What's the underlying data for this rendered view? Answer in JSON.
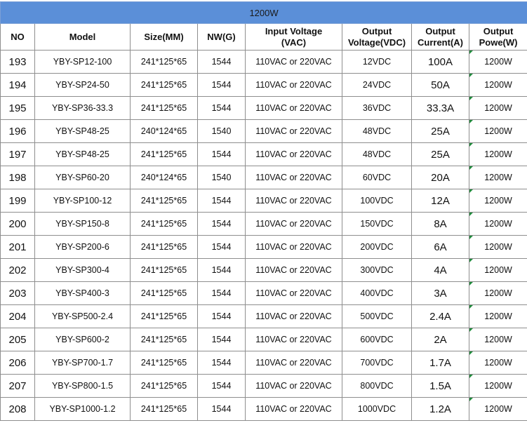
{
  "table": {
    "title": "1200W",
    "headers": {
      "no": "NO",
      "model": "Model",
      "size": "Size(MM)",
      "nw": "NW(G)",
      "input_1": "Input Voltage",
      "input_2": "(VAC)",
      "out_v_1": "Output",
      "out_v_2": "Voltage(VDC)",
      "out_c_1": "Output",
      "out_c_2": "Current(A)",
      "out_p_1": "Output",
      "out_p_2": "Powe(W)"
    },
    "rows": [
      {
        "no": "193",
        "model": "YBY-SP12-100",
        "size": "241*125*65",
        "nw": "1544",
        "input": "110VAC or 220VAC",
        "voltage": "12VDC",
        "current": "100A",
        "power": "1200W"
      },
      {
        "no": "194",
        "model": "YBY-SP24-50",
        "size": "241*125*65",
        "nw": "1544",
        "input": "110VAC or 220VAC",
        "voltage": "24VDC",
        "current": "50A",
        "power": "1200W"
      },
      {
        "no": "195",
        "model": "YBY-SP36-33.3",
        "size": "241*125*65",
        "nw": "1544",
        "input": "110VAC or 220VAC",
        "voltage": "36VDC",
        "current": "33.3A",
        "power": "1200W"
      },
      {
        "no": "196",
        "model": "YBY-SP48-25",
        "size": "240*124*65",
        "nw": "1540",
        "input": "110VAC or 220VAC",
        "voltage": "48VDC",
        "current": "25A",
        "power": "1200W"
      },
      {
        "no": "197",
        "model": "YBY-SP48-25",
        "size": "241*125*65",
        "nw": "1544",
        "input": "110VAC or 220VAC",
        "voltage": "48VDC",
        "current": "25A",
        "power": "1200W"
      },
      {
        "no": "198",
        "model": "YBY-SP60-20",
        "size": "240*124*65",
        "nw": "1540",
        "input": "110VAC or 220VAC",
        "voltage": "60VDC",
        "current": "20A",
        "power": "1200W"
      },
      {
        "no": "199",
        "model": "YBY-SP100-12",
        "size": "241*125*65",
        "nw": "1544",
        "input": "110VAC or 220VAC",
        "voltage": "100VDC",
        "current": "12A",
        "power": "1200W"
      },
      {
        "no": "200",
        "model": "YBY-SP150-8",
        "size": "241*125*65",
        "nw": "1544",
        "input": "110VAC or 220VAC",
        "voltage": "150VDC",
        "current": "8A",
        "power": "1200W"
      },
      {
        "no": "201",
        "model": "YBY-SP200-6",
        "size": "241*125*65",
        "nw": "1544",
        "input": "110VAC or 220VAC",
        "voltage": "200VDC",
        "current": "6A",
        "power": "1200W"
      },
      {
        "no": "202",
        "model": "YBY-SP300-4",
        "size": "241*125*65",
        "nw": "1544",
        "input": "110VAC or 220VAC",
        "voltage": "300VDC",
        "current": "4A",
        "power": "1200W"
      },
      {
        "no": "203",
        "model": "YBY-SP400-3",
        "size": "241*125*65",
        "nw": "1544",
        "input": "110VAC or 220VAC",
        "voltage": "400VDC",
        "current": "3A",
        "power": "1200W"
      },
      {
        "no": "204",
        "model": "YBY-SP500-2.4",
        "size": "241*125*65",
        "nw": "1544",
        "input": "110VAC or 220VAC",
        "voltage": "500VDC",
        "current": "2.4A",
        "power": "1200W"
      },
      {
        "no": "205",
        "model": "YBY-SP600-2",
        "size": "241*125*65",
        "nw": "1544",
        "input": "110VAC or 220VAC",
        "voltage": "600VDC",
        "current": "2A",
        "power": "1200W"
      },
      {
        "no": "206",
        "model": "YBY-SP700-1.7",
        "size": "241*125*65",
        "nw": "1544",
        "input": "110VAC or 220VAC",
        "voltage": "700VDC",
        "current": "1.7A",
        "power": "1200W"
      },
      {
        "no": "207",
        "model": "YBY-SP800-1.5",
        "size": "241*125*65",
        "nw": "1544",
        "input": "110VAC or 220VAC",
        "voltage": "800VDC",
        "current": "1.5A",
        "power": "1200W"
      },
      {
        "no": "208",
        "model": "YBY-SP1000-1.2",
        "size": "241*125*65",
        "nw": "1544",
        "input": "110VAC or 220VAC",
        "voltage": "1000VDC",
        "current": "1.2A",
        "power": "1200W"
      }
    ]
  },
  "colors": {
    "title_bar": "#5b8fd8",
    "grid_line": "#8e8e8e",
    "cell_marker": "#1f8a3b"
  }
}
